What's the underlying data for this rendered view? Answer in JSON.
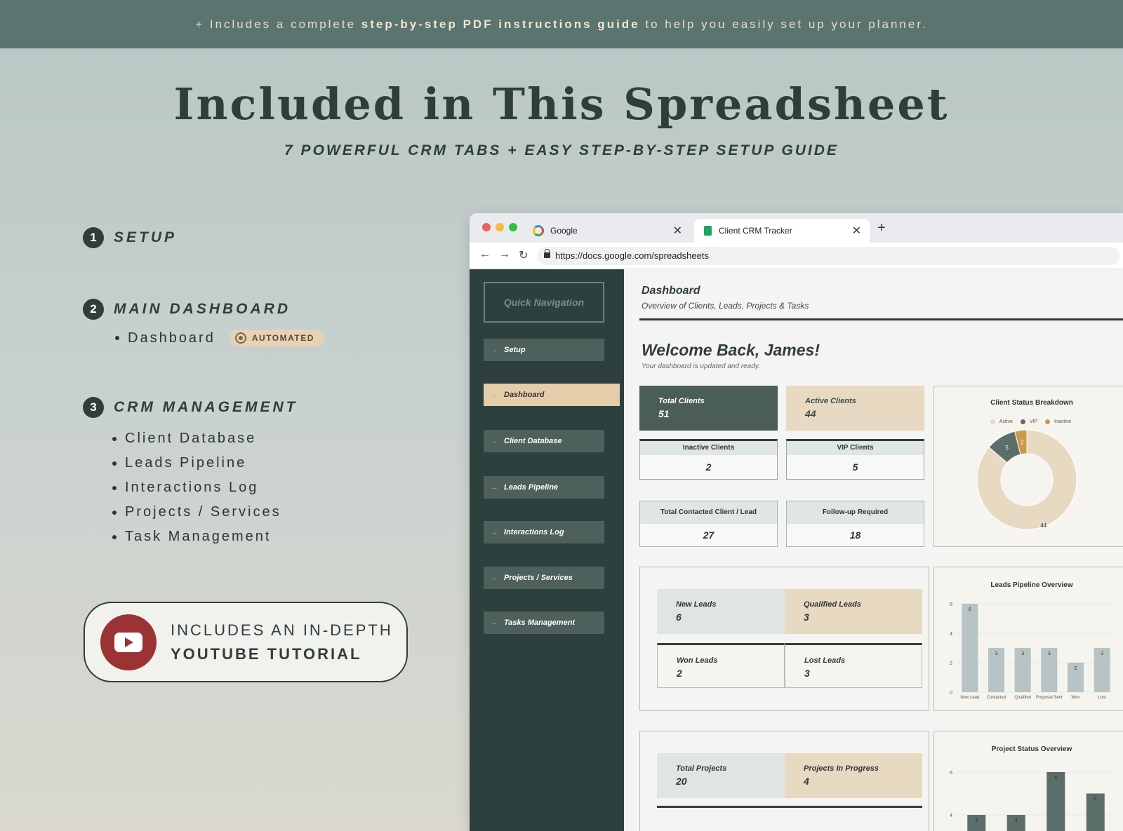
{
  "banner": {
    "prefix": "+ Includes a complete ",
    "bold": "step-by-step PDF instructions guide",
    "suffix": " to help you easily set up your planner."
  },
  "title": "Included in This Spreadsheet",
  "subtitle": "7 POWERFUL CRM TABS + EASY STEP-BY-STEP SETUP GUIDE",
  "sections": [
    {
      "num": "1",
      "title": "SETUP",
      "items": []
    },
    {
      "num": "2",
      "title": "MAIN DASHBOARD",
      "items": [
        "Dashboard"
      ],
      "badge": "AUTOMATED"
    },
    {
      "num": "3",
      "title": "CRM MANAGEMENT",
      "items": [
        "Client Database",
        "Leads Pipeline",
        "Interactions Log",
        "Projects / Services",
        "Task Management"
      ]
    }
  ],
  "youtube": {
    "line1": "INCLUDES AN IN-DEPTH",
    "line2": "YOUTUBE TUTORIAL"
  },
  "browser": {
    "tab1": "Google",
    "tab2": "Client CRM Tracker",
    "url": "https://docs.google.com/spreadsheets",
    "light_colors": [
      "#ee5f57",
      "#f6bd3b",
      "#29c440"
    ]
  },
  "sidebar": {
    "quick_nav": "Quick Navigation",
    "items": [
      "Setup",
      "Dashboard",
      "Client Database",
      "Leads Pipeline",
      "Interactions Log",
      "Projects / Services",
      "Tasks Management"
    ],
    "active": "Dashboard"
  },
  "dashboard": {
    "title": "Dashboard",
    "subtitle": "Overview of Clients, Leads, Projects & Tasks",
    "welcome": "Welcome Back, James!",
    "welcome_sub": "Your dashboard is updated and ready.",
    "clients": {
      "total_label": "Total Clients",
      "total": "51",
      "active_label": "Active Clients",
      "active": "44",
      "inactive_label": "Inactive Clients",
      "inactive": "2",
      "vip_label": "VIP Clients",
      "vip": "5",
      "contacted_label": "Total Contacted Client / Lead",
      "contacted": "27",
      "followup_label": "Follow-up Required",
      "followup": "18"
    },
    "leads": {
      "new_label": "New Leads",
      "new": "6",
      "qualified_label": "Qualified Leads",
      "qualified": "3",
      "won_label": "Won Leads",
      "won": "2",
      "lost_label": "Lost Leads",
      "lost": "3"
    },
    "projects": {
      "total_label": "Total Projects",
      "total": "20",
      "progress_label": "Projects In Progress",
      "progress": "4"
    }
  },
  "chart_data": [
    {
      "type": "pie",
      "title": "Client Status Breakdown",
      "categories": [
        "Active",
        "VIP",
        "Inactive"
      ],
      "values": [
        44,
        5,
        2
      ],
      "colors": [
        "#e8d9c3",
        "#5b6e6a",
        "#c99a4a"
      ],
      "legend": "top"
    },
    {
      "type": "bar",
      "title": "Leads Pipeline Overview",
      "categories": [
        "New Lead",
        "Contacted",
        "Qualified",
        "Proposal Sent",
        "Won",
        "Lost"
      ],
      "values": [
        6,
        3,
        3,
        3,
        2,
        3
      ],
      "ylim": [
        0,
        6
      ],
      "yticks": [
        0,
        2,
        4,
        6
      ],
      "color": "#b7c3c4"
    },
    {
      "type": "bar",
      "title": "Project Status Overview",
      "values": [
        4,
        4,
        6,
        5
      ],
      "yticks": [
        4,
        6
      ],
      "color": "#5b6e6a"
    }
  ]
}
